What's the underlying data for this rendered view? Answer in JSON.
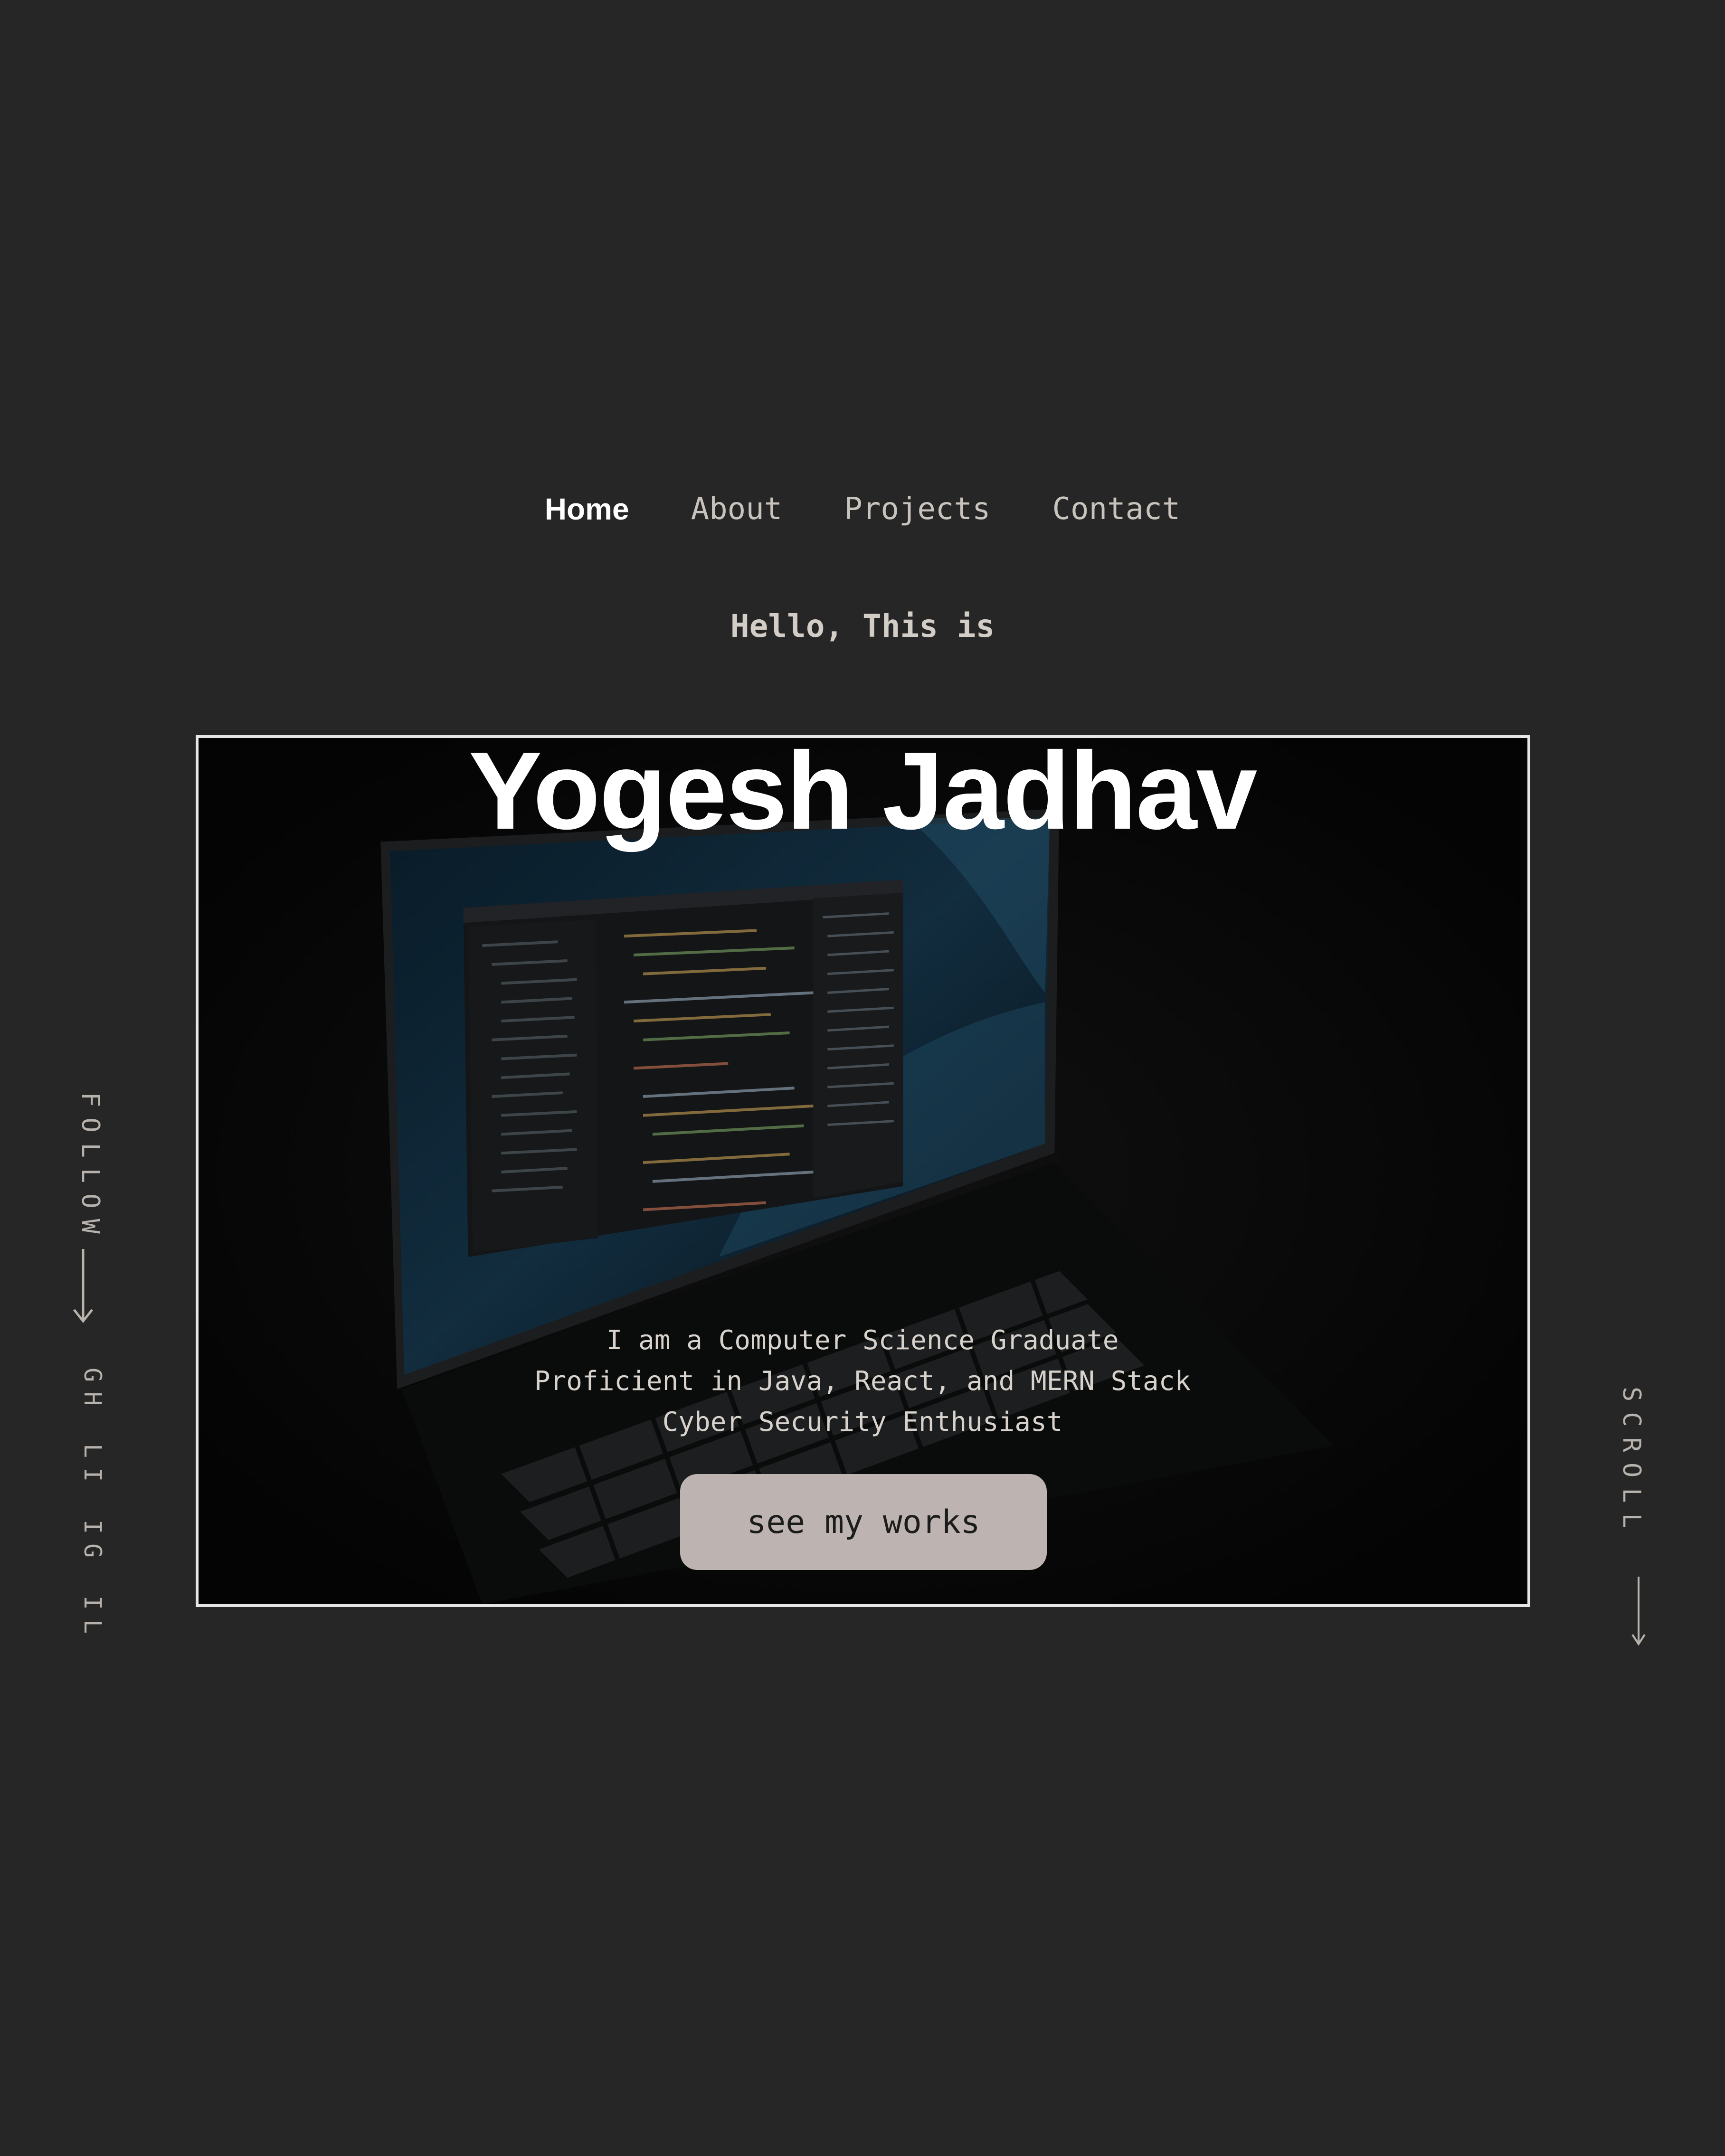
{
  "nav": {
    "items": [
      {
        "label": "Home",
        "active": true
      },
      {
        "label": "About",
        "active": false
      },
      {
        "label": "Projects",
        "active": false
      },
      {
        "label": "Contact",
        "active": false
      }
    ]
  },
  "hero": {
    "greeting": "Hello, This is",
    "name": "Yogesh Jadhav",
    "taglines": [
      "I am a Computer Science Graduate",
      "Proficient in Java, React, and MERN Stack",
      "Cyber Security Enthusiast"
    ],
    "cta_label": "see my works"
  },
  "sidebar_left": {
    "follow_text": "FOLLOW",
    "social_links": [
      "GH",
      "LI",
      "IG",
      "IL"
    ]
  },
  "sidebar_right": {
    "scroll_text": "SCROLL"
  },
  "icons": {
    "follow_arrow": "arrow-down-icon",
    "scroll_arrow": "arrow-down-icon"
  },
  "colors": {
    "background": "#262626",
    "button": "#bdb4b2",
    "frame_border": "#e6e6e6",
    "nav_active": "#ffffff",
    "nav_inactive": "#c9c3bd"
  }
}
